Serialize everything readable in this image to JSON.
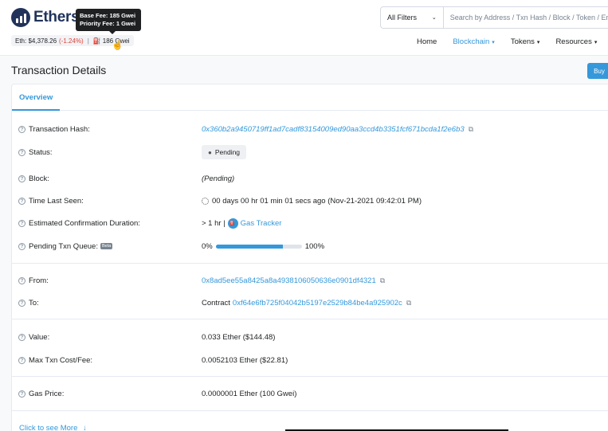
{
  "header": {
    "logo_text": "Ethers",
    "eth_price_label": "Eth: $4,378.26",
    "eth_change": "(-1.24%)",
    "separator": "|",
    "gas_text": "186 Gwei",
    "tooltip_base_fee": "Base Fee: 185 Gwei",
    "tooltip_priority_fee": "Priority Fee: 1 Gwei"
  },
  "search": {
    "filter_label": "All Filters",
    "placeholder": "Search by Address / Txn Hash / Block / Token / Ens"
  },
  "nav": {
    "home": "Home",
    "blockchain": "Blockchain",
    "tokens": "Tokens",
    "resources": "Resources"
  },
  "page": {
    "title": "Transaction Details",
    "buy_label": "Buy"
  },
  "tabs": {
    "overview": "Overview"
  },
  "details": {
    "tx_hash_label": "Transaction Hash:",
    "tx_hash_value": "0x360b2a9450719ff1ad7cadf83154009ed90aa3ccd4b3351fcf671bcda1f2e6b3",
    "status_label": "Status:",
    "status_value": "Pending",
    "block_label": "Block:",
    "block_value": "(Pending)",
    "time_label": "Time Last Seen:",
    "time_value": "00 days 00 hr 01 min 01 secs ago (Nov-21-2021 09:42:01 PM)",
    "est_label": "Estimated Confirmation Duration:",
    "est_value": "> 1 hr |",
    "gas_tracker": "Gas Tracker",
    "queue_label": "Pending Txn Queue:",
    "beta": "Beta",
    "queue_start": "0%",
    "queue_end": "100%",
    "queue_progress": 0.78,
    "from_label": "From:",
    "from_value": "0x8ad5ee55a8425a8a4938106050636e0901df4321",
    "to_label": "To:",
    "to_prefix": "Contract",
    "to_value": "0xf64e6fb725f04042b5197e2529b84be4a925902c",
    "value_label": "Value:",
    "value_value": "0.033 Ether ($144.48)",
    "max_fee_label": "Max Txn Cost/Fee:",
    "max_fee_value": "0.0052103 Ether ($22.81)",
    "gas_price_label": "Gas Price:",
    "gas_price_value": "0.0000001 Ether (100 Gwei)"
  },
  "footer": {
    "more_label": "Click to see More"
  }
}
